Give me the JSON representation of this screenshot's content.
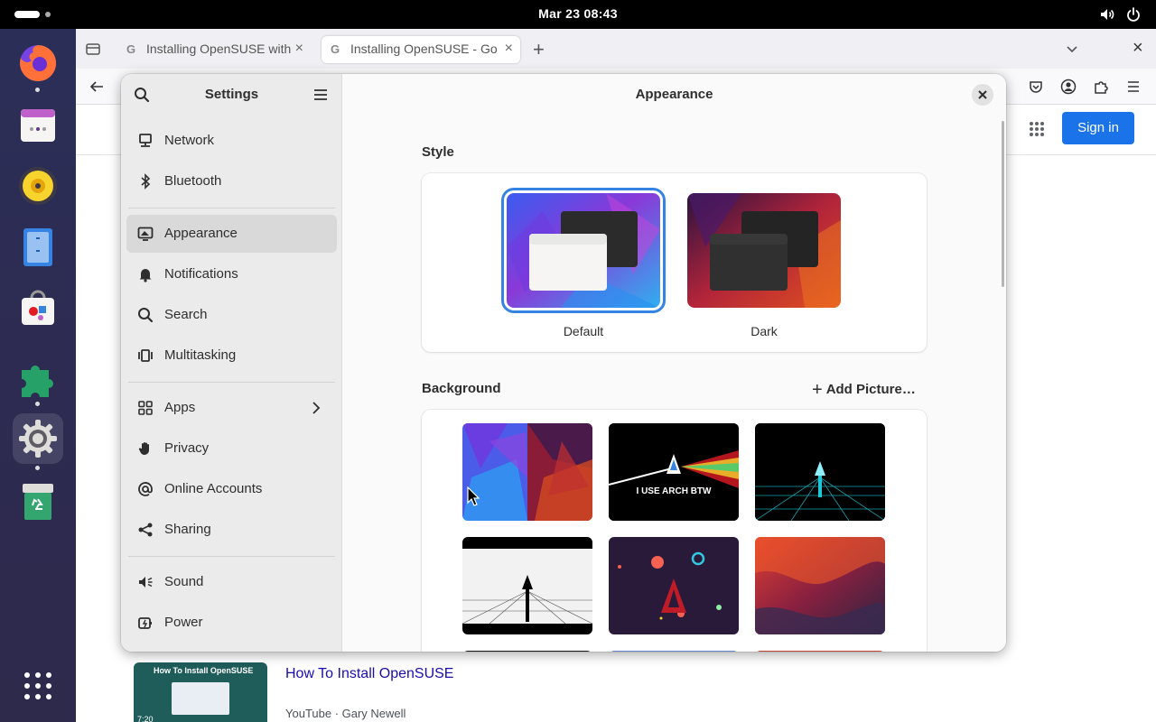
{
  "topbar": {
    "datetime": "Mar 23  08:43"
  },
  "dock": {
    "apps": [
      {
        "icon": "firefox-icon",
        "running": true
      },
      {
        "icon": "calendar-icon",
        "running": false
      },
      {
        "icon": "rhythmbox-icon",
        "running": false
      },
      {
        "icon": "files-icon",
        "running": false
      },
      {
        "icon": "software-icon",
        "running": false
      },
      {
        "icon": "extensions-icon",
        "running": false
      },
      {
        "icon": "settings-gear-icon",
        "running": true
      },
      {
        "icon": "trash-icon",
        "running": false
      }
    ],
    "app_grid_icon": "show-apps-icon"
  },
  "browser": {
    "tabs": [
      {
        "title": "Installing OpenSUSE with",
        "active": false
      },
      {
        "title": "Installing OpenSUSE - Go",
        "active": true
      }
    ],
    "signin_label": "Sign in",
    "result": {
      "thumb_title": "How To Install OpenSUSE",
      "duration": "7:20",
      "title": "How To Install OpenSUSE",
      "meta": "YouTube · Gary Newell"
    }
  },
  "settings": {
    "title": "Settings",
    "page_title": "Appearance",
    "sidebar": [
      {
        "label": "Network",
        "icon": "network-icon"
      },
      {
        "label": "Bluetooth",
        "icon": "bluetooth-icon"
      },
      {
        "label": "Appearance",
        "icon": "appearance-icon",
        "selected": true
      },
      {
        "label": "Notifications",
        "icon": "bell-icon"
      },
      {
        "label": "Search",
        "icon": "search-icon"
      },
      {
        "label": "Multitasking",
        "icon": "multitasking-icon"
      },
      {
        "label": "Apps",
        "icon": "apps-grid-icon",
        "has_submenu": true
      },
      {
        "label": "Privacy",
        "icon": "hand-icon"
      },
      {
        "label": "Online Accounts",
        "icon": "at-icon"
      },
      {
        "label": "Sharing",
        "icon": "share-icon"
      },
      {
        "label": "Sound",
        "icon": "speaker-icon"
      },
      {
        "label": "Power",
        "icon": "power-plug-icon"
      }
    ],
    "style": {
      "section_title": "Style",
      "options": [
        {
          "label": "Default",
          "selected": true
        },
        {
          "label": "Dark",
          "selected": false
        }
      ]
    },
    "background": {
      "section_title": "Background",
      "add_picture_label": "Add Picture…",
      "wallpapers": [
        {
          "name": "adwaita-day-night"
        },
        {
          "name": "i-use-arch-btw",
          "text": "I USE ARCH BTW"
        },
        {
          "name": "arch-neon-grid"
        },
        {
          "name": "arch-monochrome-road"
        },
        {
          "name": "arch-planets"
        },
        {
          "name": "red-purple-waves"
        }
      ]
    },
    "accent_color": "#3584e4"
  }
}
